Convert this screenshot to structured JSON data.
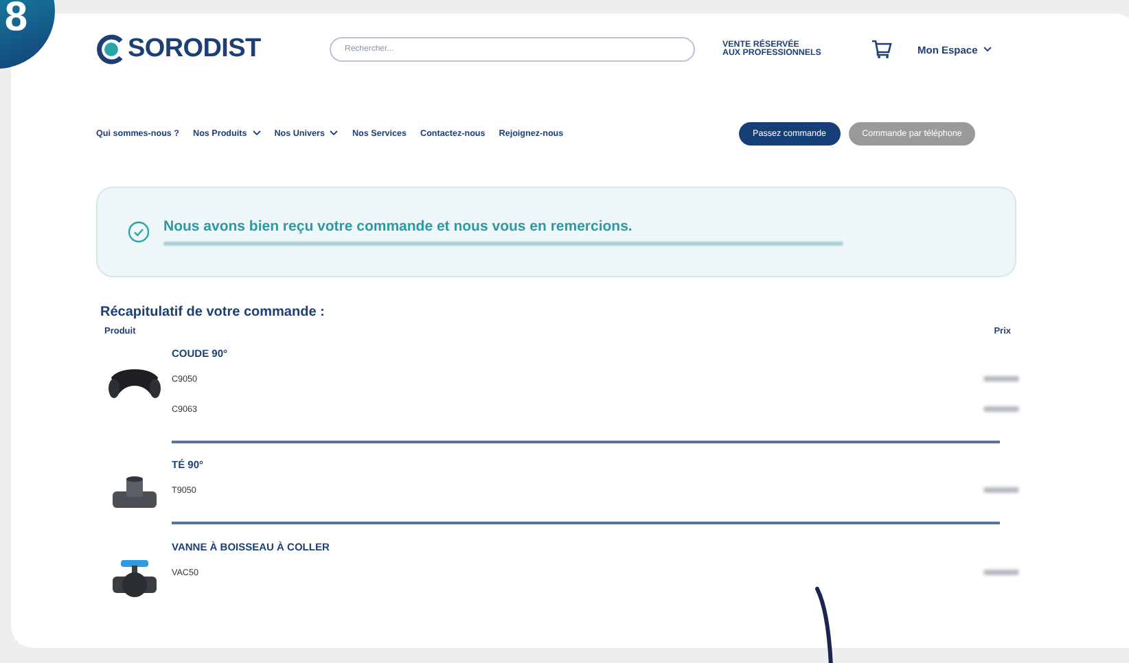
{
  "step_badge": "8",
  "header": {
    "logo": "SORODIST",
    "search": {
      "placeholder": "Rechercher..."
    },
    "notice_lines": [
      "VENTE RÉSERVÉE",
      "AUX PROFESSIONNELS"
    ],
    "account": "Mon Espace"
  },
  "nav": [
    {
      "label": "Qui sommes-nous ?",
      "dropdown": false
    },
    {
      "label": "Nos Produits",
      "dropdown": true
    },
    {
      "label": "Nos Univers",
      "dropdown": true
    },
    {
      "label": "Nos Services",
      "dropdown": false
    },
    {
      "label": "Contactez-nous",
      "dropdown": false
    },
    {
      "label": "Rejoignez-nous",
      "dropdown": false
    }
  ],
  "actions": [
    {
      "label": "Passez commande",
      "disabled": false
    },
    {
      "label": "Commande par téléphone",
      "disabled": true
    }
  ],
  "confirmation": {
    "title": "Nous avons bien reçu votre commande et nous vous en remercions."
  },
  "summary": {
    "title": "Récapitulatif de votre commande :",
    "columns": [
      "Produit",
      "Prix"
    ],
    "products": [
      {
        "name": "COUDE 90°",
        "kind": "elbow",
        "variants": [
          "C9050",
          "C9063"
        ]
      },
      {
        "name": "TÉ 90°",
        "kind": "tee",
        "variants": [
          "T9050"
        ]
      },
      {
        "name": "VANNE À BOISSEAU À COLLER",
        "kind": "valve",
        "variants": [
          "VAC50"
        ]
      }
    ]
  }
}
